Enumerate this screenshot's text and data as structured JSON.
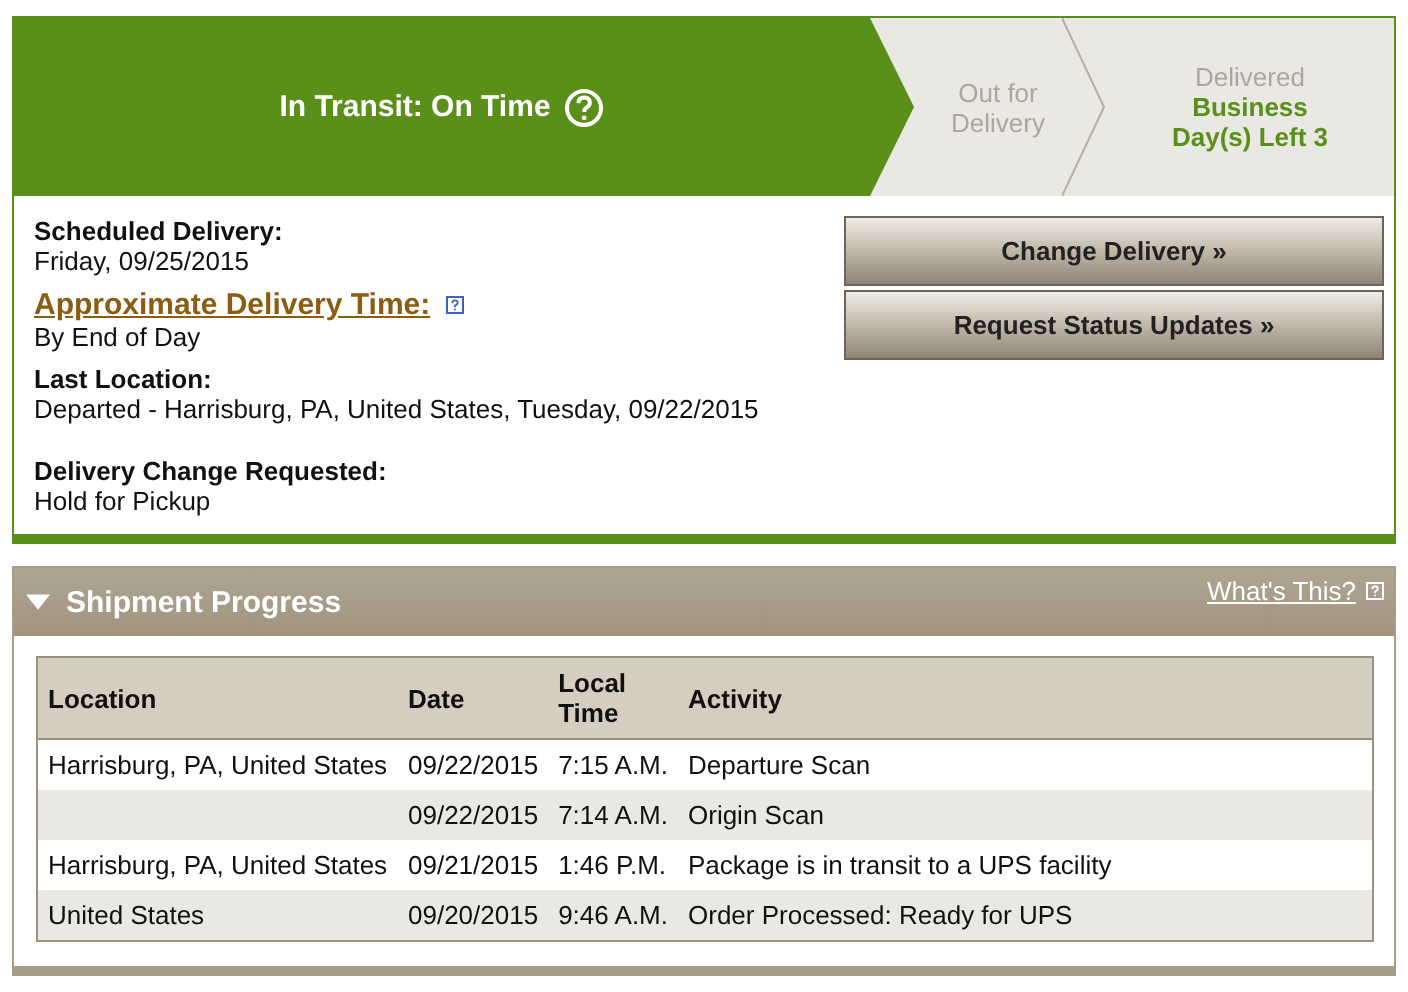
{
  "stages": [
    {
      "label": "In Transit: On Time",
      "selected": true,
      "help": true
    },
    {
      "label": "Out for Delivery",
      "selected": false,
      "help": false
    },
    {
      "label": "Delivered",
      "selected": false,
      "help": false,
      "note": "Business Day(s) Left 3"
    }
  ],
  "details": [
    {
      "kind": "plain",
      "label": "Scheduled Delivery:",
      "value": "Friday, 09/25/2015"
    },
    {
      "kind": "link",
      "label": "Approximate Delivery Time:",
      "value": "By End of Day"
    },
    {
      "kind": "plain",
      "label": "Last Location:",
      "value": "Departed - Harrisburg, PA, United States, Tuesday, 09/22/2015"
    },
    {
      "kind": "plain",
      "label": "Delivery Change Requested:",
      "value": "Hold for Pickup"
    }
  ],
  "actions": [
    "Change Delivery »",
    "Request Status Updates »"
  ],
  "progress": {
    "title": "Shipment Progress",
    "expanded": true,
    "help_link": "What's This?",
    "columns": [
      "Location",
      "Date",
      "Local Time",
      "Activity"
    ],
    "rows": [
      [
        "Harrisburg, PA, United States",
        "09/22/2015",
        "7:15 A.M.",
        "Departure Scan"
      ],
      [
        "",
        "09/22/2015",
        "7:14 A.M.",
        "Origin Scan"
      ],
      [
        "Harrisburg, PA, United States",
        "09/21/2015",
        "1:46 P.M.",
        "Package is in transit to a UPS facility"
      ],
      [
        "United States",
        "09/20/2015",
        "9:46 A.M.",
        "Order Processed: Ready for UPS"
      ]
    ]
  }
}
